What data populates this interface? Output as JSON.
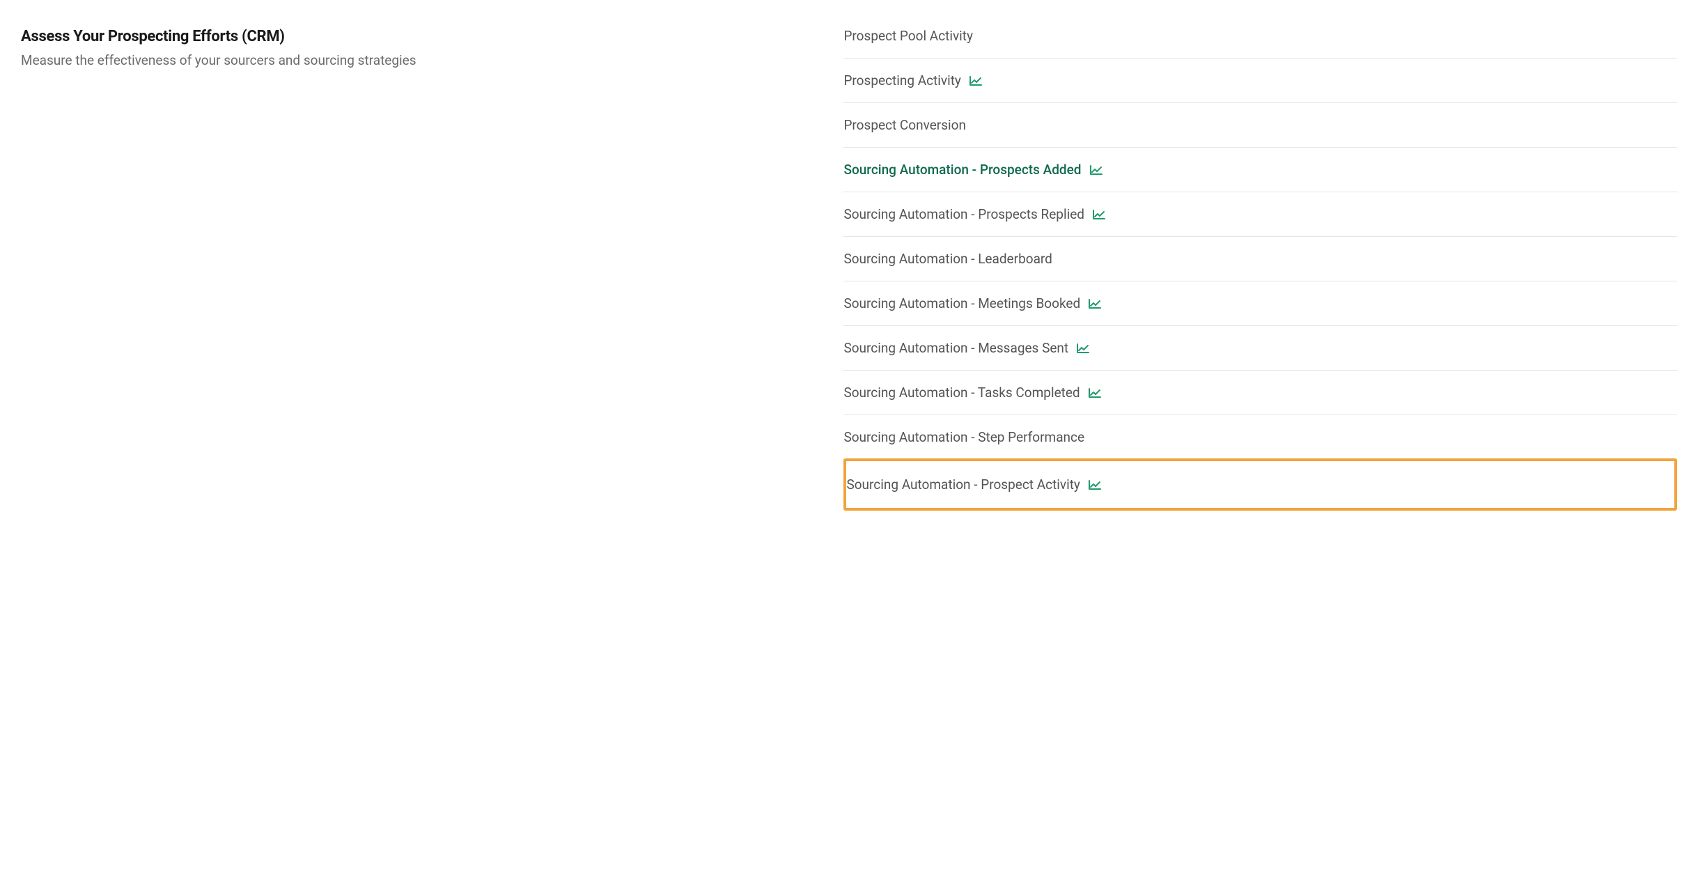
{
  "section": {
    "title": "Assess Your Prospecting Efforts (CRM)",
    "subtitle": "Measure the effectiveness of your sourcers and sourcing strategies"
  },
  "reports": [
    {
      "label": "Prospect Pool Activity",
      "has_chart_icon": false,
      "active": false,
      "highlighted": false
    },
    {
      "label": "Prospecting Activity",
      "has_chart_icon": true,
      "active": false,
      "highlighted": false
    },
    {
      "label": "Prospect Conversion",
      "has_chart_icon": false,
      "active": false,
      "highlighted": false
    },
    {
      "label": "Sourcing Automation - Prospects Added",
      "has_chart_icon": true,
      "active": true,
      "highlighted": false
    },
    {
      "label": "Sourcing Automation - Prospects Replied",
      "has_chart_icon": true,
      "active": false,
      "highlighted": false
    },
    {
      "label": "Sourcing Automation - Leaderboard",
      "has_chart_icon": false,
      "active": false,
      "highlighted": false
    },
    {
      "label": "Sourcing Automation - Meetings Booked",
      "has_chart_icon": true,
      "active": false,
      "highlighted": false
    },
    {
      "label": "Sourcing Automation - Messages Sent",
      "has_chart_icon": true,
      "active": false,
      "highlighted": false
    },
    {
      "label": "Sourcing Automation - Tasks Completed",
      "has_chart_icon": true,
      "active": false,
      "highlighted": false
    },
    {
      "label": "Sourcing Automation - Step Performance",
      "has_chart_icon": false,
      "active": false,
      "highlighted": false
    },
    {
      "label": "Sourcing Automation - Prospect Activity",
      "has_chart_icon": true,
      "active": false,
      "highlighted": true
    }
  ],
  "colors": {
    "accent_green": "#1f9b6c",
    "active_text": "#0f6b4f",
    "highlight_border": "#f2a33c"
  }
}
